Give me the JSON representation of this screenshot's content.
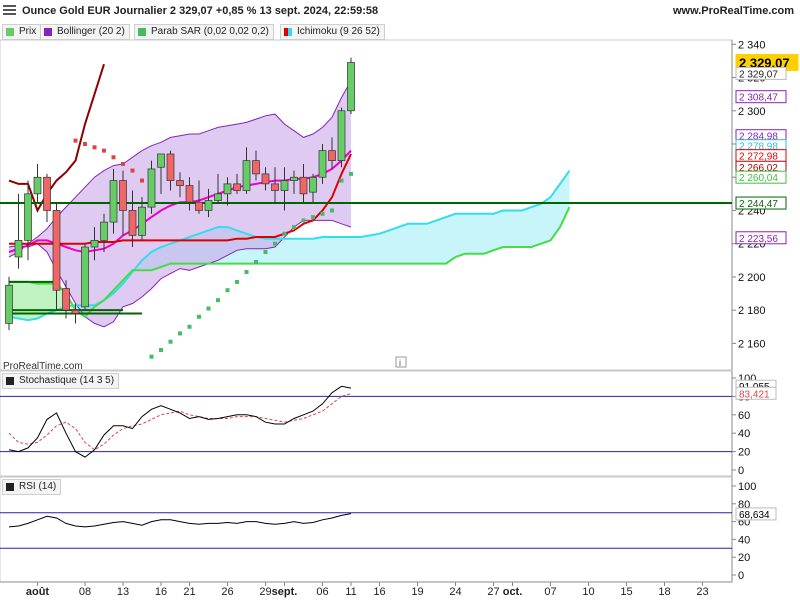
{
  "header": {
    "title": "Ounce Gold EUR Journalier 2 329,07 +0,85 % 13 sept. 2024, 22:59:58",
    "site": "www.ProRealTime.com"
  },
  "legend": {
    "price": "Prix",
    "bollinger": "Bollinger (20 2)",
    "sar": "Parab SAR (0,02 0,02 0,2)",
    "ichimoku": "Ichimoku (9 26 52)"
  },
  "watermark": "ProRealTime.com",
  "colors": {
    "up": "#66cc66",
    "down": "#ee6666",
    "bollinger_mid": "#ee00cc",
    "bollinger_band": "#8822bb",
    "bollinger_fill": "#c9a8e8",
    "sar": "#44bb66",
    "tenkan": "#dd0000",
    "kijun": "#aa0000",
    "chikou": "#8b0000",
    "span_a": "#44dd44",
    "span_b": "#33ddee",
    "hline": "#006600",
    "stoch_k": "#000000",
    "stoch_d": "#dd4444",
    "rsi": "#000000",
    "level_line": "#2222aa"
  },
  "chart_data": [
    {
      "type": "candlestick",
      "panel": "price",
      "title": "Ounce Gold EUR Journalier",
      "ylim": [
        2150,
        2345
      ],
      "y_ticks": [
        2340,
        2320,
        2300,
        2280,
        2260,
        2240,
        2220,
        2200,
        2180,
        2160
      ],
      "y_tick_labels": [
        "2 340",
        "2 320",
        "2 300",
        "2 280",
        "2 260",
        "2 240",
        "2 220",
        "2 200",
        "2 180",
        "2 160"
      ],
      "x_ticks": [
        {
          "i": 3,
          "label": "août",
          "bold": true
        },
        {
          "i": 8,
          "label": "08"
        },
        {
          "i": 12,
          "label": "13"
        },
        {
          "i": 16,
          "label": "16"
        },
        {
          "i": 19,
          "label": "21"
        },
        {
          "i": 23,
          "label": "26"
        },
        {
          "i": 27,
          "label": "29"
        },
        {
          "i": 29,
          "label": "sept.",
          "bold": true
        },
        {
          "i": 33,
          "label": "06"
        },
        {
          "i": 36,
          "label": "11"
        },
        {
          "i": 39,
          "label": "16"
        },
        {
          "i": 43,
          "label": "19"
        },
        {
          "i": 47,
          "label": "24"
        },
        {
          "i": 51,
          "label": "27"
        },
        {
          "i": 53,
          "label": "oct.",
          "bold": true
        },
        {
          "i": 57,
          "label": "07"
        },
        {
          "i": 61,
          "label": "10"
        },
        {
          "i": 65,
          "label": "15"
        },
        {
          "i": 69,
          "label": "18"
        },
        {
          "i": 73,
          "label": "23"
        }
      ],
      "candles": [
        {
          "o": 2172,
          "h": 2200,
          "l": 2168,
          "c": 2195
        },
        {
          "o": 2212,
          "h": 2250,
          "l": 2205,
          "c": 2222
        },
        {
          "o": 2222,
          "h": 2258,
          "l": 2210,
          "c": 2250
        },
        {
          "o": 2250,
          "h": 2268,
          "l": 2245,
          "c": 2260
        },
        {
          "o": 2260,
          "h": 2262,
          "l": 2233,
          "c": 2240
        },
        {
          "o": 2240,
          "h": 2245,
          "l": 2180,
          "c": 2192
        },
        {
          "o": 2193,
          "h": 2198,
          "l": 2175,
          "c": 2180
        },
        {
          "o": 2180,
          "h": 2184,
          "l": 2172,
          "c": 2178
        },
        {
          "o": 2182,
          "h": 2220,
          "l": 2180,
          "c": 2218
        },
        {
          "o": 2218,
          "h": 2230,
          "l": 2210,
          "c": 2222
        },
        {
          "o": 2222,
          "h": 2238,
          "l": 2215,
          "c": 2233
        },
        {
          "o": 2233,
          "h": 2265,
          "l": 2226,
          "c": 2258
        },
        {
          "o": 2258,
          "h": 2264,
          "l": 2225,
          "c": 2240
        },
        {
          "o": 2240,
          "h": 2252,
          "l": 2218,
          "c": 2225
        },
        {
          "o": 2225,
          "h": 2248,
          "l": 2222,
          "c": 2242
        },
        {
          "o": 2242,
          "h": 2270,
          "l": 2238,
          "c": 2265
        },
        {
          "o": 2266,
          "h": 2274,
          "l": 2250,
          "c": 2274
        },
        {
          "o": 2274,
          "h": 2276,
          "l": 2252,
          "c": 2258
        },
        {
          "o": 2258,
          "h": 2263,
          "l": 2248,
          "c": 2255
        },
        {
          "o": 2255,
          "h": 2260,
          "l": 2240,
          "c": 2245
        },
        {
          "o": 2245,
          "h": 2258,
          "l": 2238,
          "c": 2240
        },
        {
          "o": 2240,
          "h": 2253,
          "l": 2236,
          "c": 2246
        },
        {
          "o": 2246,
          "h": 2262,
          "l": 2244,
          "c": 2250
        },
        {
          "o": 2250,
          "h": 2260,
          "l": 2243,
          "c": 2256
        },
        {
          "o": 2256,
          "h": 2262,
          "l": 2250,
          "c": 2252
        },
        {
          "o": 2252,
          "h": 2278,
          "l": 2250,
          "c": 2270
        },
        {
          "o": 2270,
          "h": 2276,
          "l": 2258,
          "c": 2262
        },
        {
          "o": 2262,
          "h": 2266,
          "l": 2252,
          "c": 2256
        },
        {
          "o": 2256,
          "h": 2266,
          "l": 2244,
          "c": 2252
        },
        {
          "o": 2252,
          "h": 2266,
          "l": 2240,
          "c": 2258
        },
        {
          "o": 2258,
          "h": 2264,
          "l": 2250,
          "c": 2260
        },
        {
          "o": 2260,
          "h": 2268,
          "l": 2245,
          "c": 2250
        },
        {
          "o": 2251,
          "h": 2262,
          "l": 2245,
          "c": 2260
        },
        {
          "o": 2260,
          "h": 2280,
          "l": 2256,
          "c": 2276
        },
        {
          "o": 2276,
          "h": 2284,
          "l": 2265,
          "c": 2270
        },
        {
          "o": 2270,
          "h": 2302,
          "l": 2266,
          "c": 2300
        },
        {
          "o": 2300,
          "h": 2332,
          "l": 2298,
          "c": 2329.07
        }
      ],
      "bollinger_upper": [
        2212,
        2215,
        2220,
        2224,
        2229,
        2236,
        2242,
        2248,
        2254,
        2260,
        2264,
        2267,
        2268,
        2272,
        2276,
        2279,
        2281,
        2284,
        2285,
        2286,
        2286,
        2288,
        2290,
        2291,
        2292,
        2293,
        2295,
        2297,
        2298,
        2292,
        2288,
        2284,
        2286,
        2290,
        2296,
        2308,
        2318
      ],
      "bollinger_mid": [
        2215,
        2217,
        2219,
        2222,
        2222,
        2220,
        2218,
        2216,
        2215,
        2216,
        2217,
        2220,
        2225,
        2228,
        2232,
        2236,
        2240,
        2243,
        2245,
        2245,
        2246,
        2248,
        2250,
        2252,
        2254,
        2255,
        2256,
        2257,
        2258,
        2258,
        2259,
        2259,
        2260,
        2262,
        2265,
        2270,
        2276
      ],
      "bollinger_lower": [
        2218,
        2219,
        2218,
        2220,
        2215,
        2204,
        2194,
        2184,
        2176,
        2172,
        2170,
        2173,
        2182,
        2184,
        2188,
        2193,
        2199,
        2202,
        2205,
        2204,
        2206,
        2208,
        2210,
        2213,
        2216,
        2217,
        2217,
        2217,
        2218,
        2224,
        2230,
        2234,
        2234,
        2234,
        2234,
        2232,
        2230
      ],
      "sar": [
        null,
        null,
        null,
        null,
        null,
        null,
        null,
        2282,
        2280,
        2278,
        2276,
        2272,
        2268,
        2264,
        2258,
        2152,
        2156,
        2161,
        2166,
        2170,
        2176,
        2181,
        2186,
        2192,
        2197,
        2203,
        2209,
        2215,
        2220,
        2226,
        2230,
        2234,
        2236,
        2238,
        2240,
        2258,
        2262
      ],
      "tenkan": [
        2220,
        2220,
        2220,
        2220,
        2220,
        2220,
        2220,
        2220,
        2220,
        2221,
        2221,
        2221,
        2222,
        2222,
        2222,
        2222,
        2222,
        2222,
        2222,
        2222,
        2222,
        2222,
        2222,
        2222,
        2223,
        2223,
        2224,
        2224,
        2224,
        2226,
        2228,
        2232,
        2234,
        2240,
        2248,
        2262,
        2274
      ],
      "kijun_segments": [
        {
          "from": 0,
          "to": 5,
          "value": 2197
        },
        {
          "from": 0,
          "to": 12,
          "value": 2180
        },
        {
          "from": 0,
          "to": 14,
          "value": 2178
        }
      ],
      "chikou": [
        2258,
        2256,
        2256,
        2240,
        2250,
        2258,
        2263,
        2270,
        2292,
        2310,
        2328
      ],
      "span_b": [
        2176,
        2175,
        2174,
        2175,
        2178,
        2180,
        2182,
        2183,
        2183,
        2183,
        2186,
        2190,
        2196,
        2203,
        2210,
        2215,
        2218,
        2220,
        2222,
        2224,
        2226,
        2228,
        2230,
        2230,
        2228,
        2226,
        2224,
        2223,
        2223,
        2223,
        2223,
        2223,
        2223,
        2224,
        2224,
        2224,
        2224,
        2224,
        2225,
        2226,
        2228,
        2230,
        2232,
        2232,
        2232,
        2234,
        2236,
        2238,
        2238,
        2238,
        2238,
        2238,
        2240,
        2240,
        2240,
        2242,
        2244,
        2248,
        2256,
        2264
      ],
      "span_a": [
        2197,
        2197,
        2197,
        2196,
        2196,
        2196,
        2190,
        2180,
        2176,
        2182,
        2186,
        2192,
        2198,
        2204,
        2204,
        2204,
        2206,
        2208,
        2208,
        2208,
        2208,
        2208,
        2208,
        2208,
        2208,
        2208,
        2208,
        2208,
        2208,
        2208,
        2208,
        2208,
        2208,
        2208,
        2208,
        2208,
        2208,
        2208,
        2208,
        2208,
        2208,
        2208,
        2208,
        2208,
        2208,
        2208,
        2208,
        2212,
        2214,
        2214,
        2214,
        2216,
        2218,
        2218,
        2218,
        2218,
        2220,
        2222,
        2230,
        2242
      ],
      "hline": 2244.47,
      "right_labels": [
        {
          "v": 2329.07,
          "text": "2 329,07",
          "bg": "#ffd000",
          "fg": "#000000",
          "big": true
        },
        {
          "v": 2322.5,
          "text": "2 329,07",
          "bg": "#ffffff",
          "fg": "#222222",
          "border": "#bbbbbb"
        },
        {
          "v": 2308.47,
          "text": "2 308,47",
          "bg": "#ffffff",
          "fg": "#8822bb",
          "border": "#8822bb"
        },
        {
          "v": 2284.98,
          "text": "2 284,98",
          "bg": "#ffffff",
          "fg": "#8822bb",
          "border": "#8822bb"
        },
        {
          "v": 2278.98,
          "text": "2 278,98",
          "bg": "#ffffff",
          "fg": "#33bbcc",
          "border": "#33bbcc"
        },
        {
          "v": 2272.98,
          "text": "2 272,98",
          "bg": "#ffffff",
          "fg": "#dd0000",
          "border": "#dd0000"
        },
        {
          "v": 2266.02,
          "text": "2 266,02",
          "bg": "#ffffff",
          "fg": "#aa0000",
          "border": "#aa0000"
        },
        {
          "v": 2260.04,
          "text": "2 260,04",
          "bg": "#ffffff",
          "fg": "#44bb44",
          "border": "#44bb44"
        },
        {
          "v": 2244.47,
          "text": "2 244,47",
          "bg": "#ffffff",
          "fg": "#006600",
          "border": "#006600"
        },
        {
          "v": 2223.56,
          "text": "2 223,56",
          "bg": "#ffffff",
          "fg": "#8822bb",
          "border": "#8822bb"
        }
      ]
    },
    {
      "type": "line",
      "panel": "stochastic",
      "title": "Stochastique (14 3 5)",
      "ylim": [
        0,
        100
      ],
      "y_ticks": [
        0,
        20,
        40,
        60,
        80,
        100
      ],
      "levels": [
        20,
        80
      ],
      "series": [
        {
          "name": "%K",
          "values": [
            22,
            20,
            24,
            35,
            55,
            62,
            40,
            20,
            14,
            22,
            38,
            48,
            48,
            45,
            58,
            66,
            70,
            66,
            62,
            56,
            58,
            55,
            56,
            58,
            60,
            60,
            58,
            52,
            50,
            50,
            56,
            60,
            64,
            72,
            84,
            91,
            89
          ]
        },
        {
          "name": "%D",
          "values": [
            40,
            30,
            28,
            30,
            38,
            48,
            52,
            45,
            30,
            22,
            28,
            38,
            45,
            48,
            50,
            55,
            60,
            62,
            64,
            60,
            58,
            56,
            56,
            56,
            58,
            58,
            58,
            56,
            54,
            52,
            54,
            56,
            60,
            64,
            72,
            80,
            83
          ]
        }
      ],
      "right_labels": [
        {
          "v": 91.055,
          "text": "91,055",
          "fg": "#000000"
        },
        {
          "v": 83.421,
          "text": "83,421",
          "fg": "#dd4444"
        }
      ]
    },
    {
      "type": "line",
      "panel": "rsi",
      "title": "RSI (14)",
      "ylim": [
        0,
        100
      ],
      "y_ticks": [
        0,
        20,
        40,
        60,
        80,
        100
      ],
      "levels": [
        30,
        70
      ],
      "series": [
        {
          "name": "RSI",
          "values": [
            54,
            55,
            58,
            62,
            66,
            64,
            58,
            55,
            54,
            55,
            57,
            59,
            60,
            58,
            56,
            60,
            62,
            62,
            60,
            58,
            57,
            58,
            58,
            59,
            58,
            60,
            60,
            58,
            57,
            58,
            60,
            58,
            59,
            62,
            64,
            67,
            69
          ]
        }
      ],
      "right_labels": [
        {
          "v": 68.634,
          "text": "68,634",
          "fg": "#000000"
        }
      ]
    }
  ]
}
